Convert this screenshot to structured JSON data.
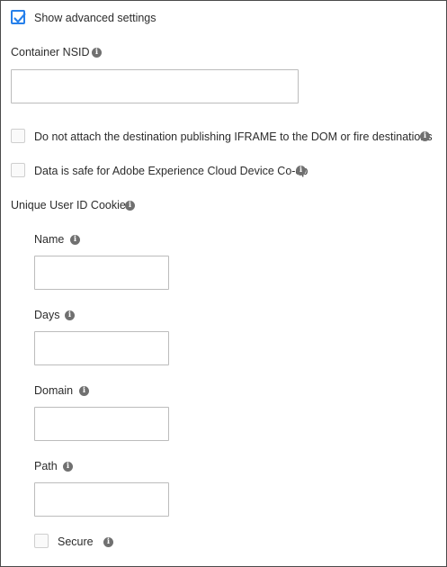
{
  "advanced": {
    "label": "Show advanced settings",
    "checked": true
  },
  "container_nsid": {
    "label": "Container NSID",
    "value": "",
    "info_icon": "info-icon"
  },
  "options": [
    {
      "label": "Do not attach the destination publishing IFRAME to the DOM or fire destinations",
      "checked": false
    },
    {
      "label": "Data is safe for Adobe Experience Cloud Device Co-op",
      "checked": false
    }
  ],
  "cookie": {
    "section_label": "Unique User ID Cookie",
    "name": {
      "label": "Name",
      "value": ""
    },
    "days": {
      "label": "Days",
      "value": ""
    },
    "domain": {
      "label": "Domain",
      "value": ""
    },
    "path": {
      "label": "Path",
      "value": ""
    },
    "secure": {
      "label": "Secure",
      "checked": false
    }
  },
  "colors": {
    "accent": "#2680eb",
    "text": "#2c2c2c",
    "info_icon": "#707070",
    "field_border": "#bcbcbc"
  }
}
